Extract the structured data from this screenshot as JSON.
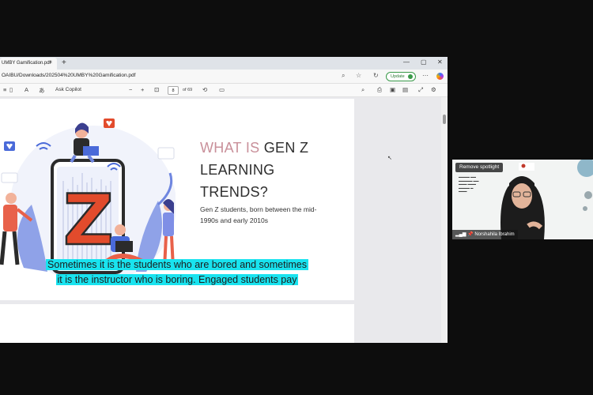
{
  "browser": {
    "tab_title": "UMBY Gamification.pdf",
    "tab_close": "×",
    "new_tab": "+",
    "window_controls": [
      "—",
      "▢",
      "✕"
    ],
    "url": "OAIBU/Downloads/202504%20UMBY%20Gamification.pdf",
    "update_label": "Update"
  },
  "pdf_toolbar": {
    "ask_copilot": "Ask Copilot",
    "zoom_out": "−",
    "zoom_in": "+",
    "page_number": "8",
    "page_total": "of 69"
  },
  "slide": {
    "title_highlight": "WHAT IS",
    "title_rest_line1": " GEN Z",
    "title_line2": "LEARNING",
    "title_line3": "TRENDS?",
    "subtitle": "Gen Z students, born between the mid-1990s and early 2010s",
    "illustration_letter": "Z"
  },
  "caption": {
    "line1": "Sometimes it is the students who are bored and sometimes",
    "line2": "it is the instructor who is boring. Engaged students pay"
  },
  "video": {
    "spotlight_label": "Remove spotlight",
    "participant_name": "Norshahila Ibrahim"
  },
  "colors": {
    "caption_highlight": "#19e3ef",
    "title_accent": "#c9909a",
    "illustration_red": "#e24b2c",
    "illustration_blue": "#4a6ad9"
  }
}
